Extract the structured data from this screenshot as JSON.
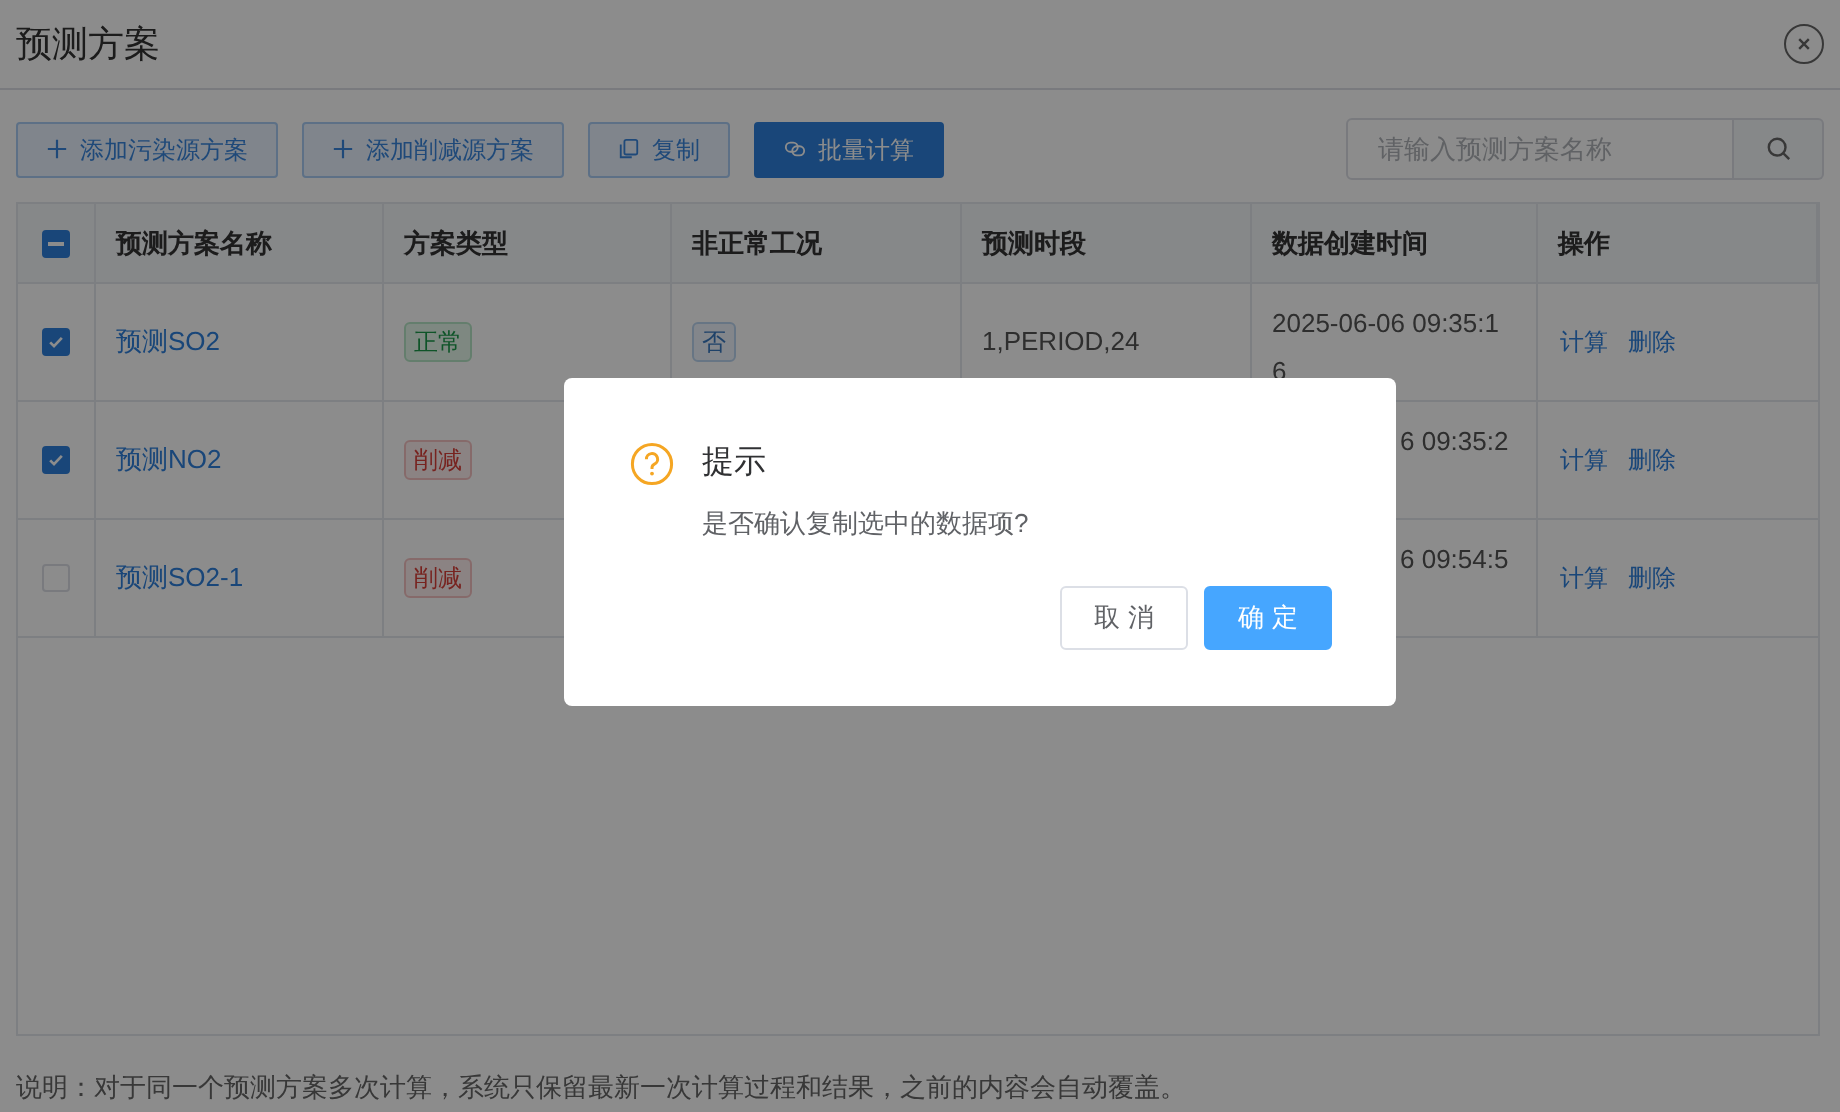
{
  "title": "预测方案",
  "toolbar": {
    "buttons": [
      {
        "label": "添加污染源方案",
        "kind": "add"
      },
      {
        "label": "添加削减源方案",
        "kind": "add"
      },
      {
        "label": "复制",
        "kind": "copy"
      },
      {
        "label": "批量计算",
        "kind": "batch"
      }
    ],
    "search": {
      "placeholder": "请输入预测方案名称"
    }
  },
  "table": {
    "select_all": {
      "indeterminate": true
    },
    "columns": [
      "预测方案名称",
      "方案类型",
      "非正常工况",
      "预测时段",
      "数据创建时间",
      "操作"
    ],
    "rows": [
      {
        "checked": true,
        "name": "预测SO2",
        "type": {
          "label": "正常",
          "kind": "normal"
        },
        "abnormal": "否",
        "period": "1,PERIOD,24",
        "created": "2025-06-06 09:35:16",
        "actions": [
          "计算",
          "删除"
        ]
      },
      {
        "checked": true,
        "name": "预测NO2",
        "type": {
          "label": "削减",
          "kind": "reduce"
        },
        "created": "6 09:35:2",
        "actions": [
          "计算",
          "删除"
        ]
      },
      {
        "checked": false,
        "name": "预测SO2-1",
        "type": {
          "label": "削减",
          "kind": "reduce"
        },
        "created": "6 09:54:5",
        "actions": [
          "计算",
          "删除"
        ]
      }
    ]
  },
  "note": "说明：对于同一个预测方案多次计算，系统只保留最新一次计算过程和结果，之前的内容会自动覆盖。",
  "dialog": {
    "title": "提示",
    "message": "是否确认复制选中的数据项?",
    "buttons": [
      {
        "label": "取 消",
        "kind": "default"
      },
      {
        "label": "确 定",
        "kind": "primary"
      }
    ]
  }
}
